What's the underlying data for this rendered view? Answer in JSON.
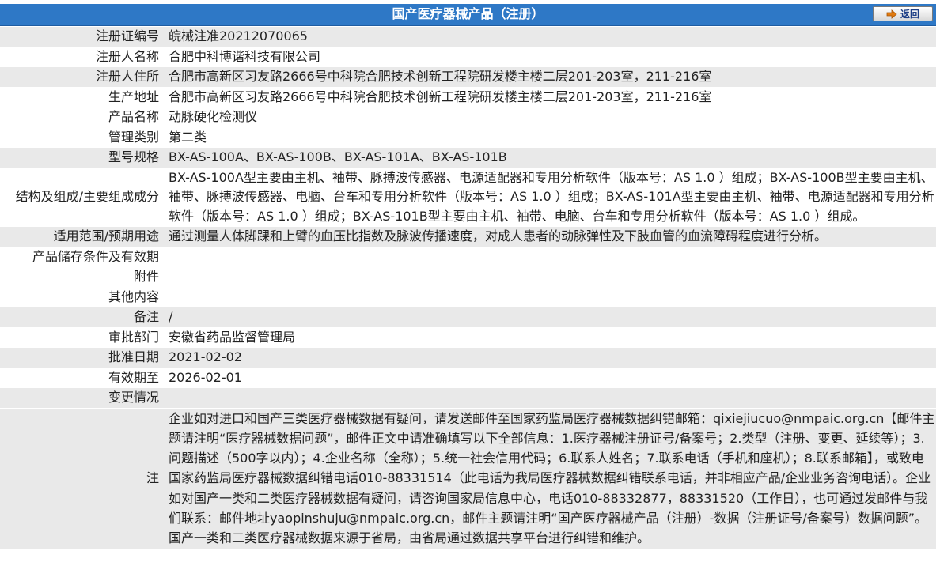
{
  "header": {
    "title": "国产医疗器械产品（注册）",
    "back_label": "返回"
  },
  "fields": [
    {
      "label": "注册证编号",
      "value": "皖械注准20212070065"
    },
    {
      "label": "注册人名称",
      "value": "合肥中科博谐科技有限公司"
    },
    {
      "label": "注册人住所",
      "value": "合肥市高新区习友路2666号中科院合肥技术创新工程院研发楼主楼二层201-203室，211-216室"
    },
    {
      "label": "生产地址",
      "value": "合肥市高新区习友路2666号中科院合肥技术创新工程院研发楼主楼二层201-203室，211-216室"
    },
    {
      "label": "产品名称",
      "value": "动脉硬化检测仪"
    },
    {
      "label": "管理类别",
      "value": "第二类"
    },
    {
      "label": "型号规格",
      "value": "BX-AS-100A、BX-AS-100B、BX-AS-101A、BX-AS-101B"
    },
    {
      "label": "结构及组成/主要组成成分",
      "value": "BX-AS-100A型主要由主机、袖带、脉搏波传感器、电源适配器和专用分析软件（版本号：AS 1.0 ）组成；BX-AS-100B型主要由主机、袖带、脉搏波传感器、电脑、台车和专用分析软件（版本号：AS 1.0 ）组成；BX-AS-101A型主要由主机、袖带、电源适配器和专用分析软件（版本号：AS 1.0 ）组成；BX-AS-101B型主要由主机、袖带、电脑、台车和专用分析软件（版本号：AS 1.0 ）组成。"
    },
    {
      "label": "适用范围/预期用途",
      "value": "通过测量人体脚踝和上臂的血压比指数及脉波传播速度，对成人患者的动脉弹性及下肢血管的血流障碍程度进行分析。"
    },
    {
      "label": "产品储存条件及有效期",
      "value": ""
    },
    {
      "label": "附件",
      "value": ""
    },
    {
      "label": "其他内容",
      "value": ""
    },
    {
      "label": "备注",
      "value": "/"
    },
    {
      "label": "审批部门",
      "value": "安徽省药品监督管理局"
    },
    {
      "label": "批准日期",
      "value": "2021-02-02"
    },
    {
      "label": "有效期至",
      "value": "2026-02-01"
    },
    {
      "label": "变更情况",
      "value": ""
    },
    {
      "label": "注",
      "value": "企业如对进口和国产三类医疗器械数据有疑问，请发送邮件至国家药监局医疗器械数据纠错邮箱：qixiejiucuo@nmpaic.org.cn【邮件主题请注明“医疗器械数据问题”，邮件正文中请准确填写以下全部信息：1.医疗器械注册证号/备案号；2.类型（注册、变更、延续等）；3.问题描述（500字以内）；4.企业名称（全称）；5.统一社会信用代码；6.联系人姓名；7.联系电话（手机和座机）；8.联系邮箱】，或致电国家药监局医疗器械数据纠错电话010-88331514（此电话为我局医疗器械数据纠错联系电话，并非相应产品/企业业务咨询电话）。企业如对国产一类和二类医疗器械数据有疑问，请咨询国家局信息中心，电话010-88332877，88331520（工作日），也可通过发邮件与我们联系：邮件地址yaopinshuju@nmpaic.org.cn，邮件主题请注明“国产医疗器械产品（注册）-数据（注册证号/备案号）数据问题”。国产一类和二类医疗器械数据来源于省局，由省局通过数据共享平台进行纠错和维护。"
    }
  ],
  "colors": {
    "title_bar": "#2e78c6",
    "row_shade": "#e9e9e9",
    "row_plain": "#ffffff",
    "back_text": "#1e3f86",
    "back_arrow": "#e07a10"
  },
  "icons": {
    "back": "arrow-right-icon"
  }
}
